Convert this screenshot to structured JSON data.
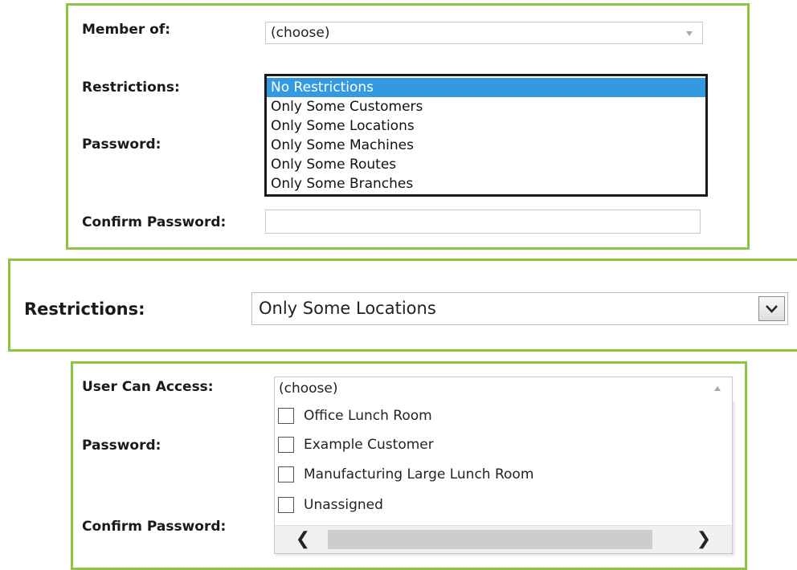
{
  "panel1": {
    "member_label": "Member of:",
    "member_value": "(choose)",
    "restrictions_label": "Restrictions:",
    "password_label": "Password:",
    "confirm_label": "Confirm Password:",
    "confirm_value": "",
    "options": [
      "No Restrictions",
      "Only Some Customers",
      "Only Some Locations",
      "Only Some Machines",
      "Only Some Routes",
      "Only Some Branches"
    ],
    "selected_option": "No Restrictions"
  },
  "panel2": {
    "restrictions_label": "Restrictions:",
    "restrictions_value": "Only Some Locations"
  },
  "panel3": {
    "access_label": "User Can Access:",
    "access_value": "(choose)",
    "password_label": "Password:",
    "confirm_label": "Confirm Password:",
    "locations": [
      {
        "label": "Office Lunch Room",
        "checked": false
      },
      {
        "label": "Example Customer",
        "checked": false
      },
      {
        "label": "Manufacturing Large Lunch Room",
        "checked": false
      },
      {
        "label": "Unassigned",
        "checked": false
      }
    ]
  },
  "colors": {
    "panel_border": "#8cc63f",
    "selection": "#3399e0"
  },
  "icons": {
    "dropdown": "chevron-down-icon",
    "scroll_left": "chevron-left-icon",
    "scroll_right": "chevron-right-icon"
  }
}
